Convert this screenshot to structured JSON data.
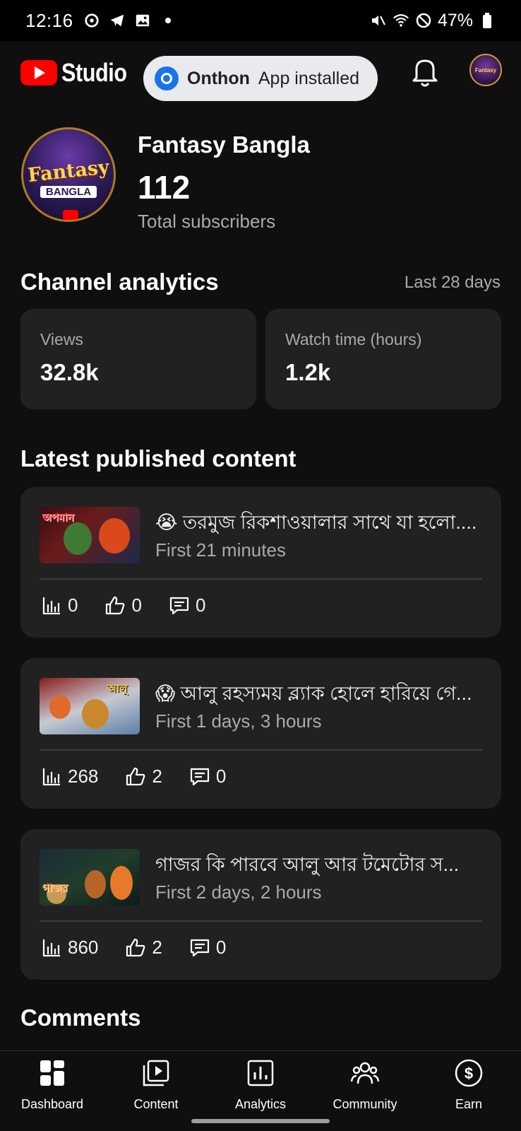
{
  "status_bar": {
    "time": "12:16",
    "battery": "47%"
  },
  "header": {
    "app_name": "Studio",
    "toast": {
      "app": "Onthon",
      "message": "App installed"
    }
  },
  "channel": {
    "name": "Fantasy Bangla",
    "subscribers": "112",
    "subscribers_label": "Total subscribers",
    "avatar_text": [
      "Fantasy",
      "BANGLA"
    ]
  },
  "analytics": {
    "title": "Channel analytics",
    "range": "Last 28 days",
    "views_label": "Views",
    "views_value": "32.8k",
    "watch_label": "Watch time (hours)",
    "watch_value": "1.2k"
  },
  "latest": {
    "title": "Latest published content",
    "items": [
      {
        "title": "😭 তরমুজ রিকশাওয়ালার সাথে যা হলো....",
        "sub": "First 21 minutes",
        "views": "0",
        "likes": "0",
        "comments": "0",
        "thumb_text": "অপমান"
      },
      {
        "title": "😱 আলু রহস্যময় ব্ল্যাক হোলে হারিয়ে গে...",
        "sub": "First 1 days, 3 hours",
        "views": "268",
        "likes": "2",
        "comments": "0",
        "thumb_text": "আলু"
      },
      {
        "title": "গাজর কি পারবে আলু আর টমেটোর স...",
        "sub": "First 2 days, 2 hours",
        "views": "860",
        "likes": "2",
        "comments": "0",
        "thumb_text": "গাজর"
      }
    ]
  },
  "comments_title": "Comments",
  "nav": [
    {
      "label": "Dashboard",
      "icon": "dashboard-icon"
    },
    {
      "label": "Content",
      "icon": "content-icon"
    },
    {
      "label": "Analytics",
      "icon": "analytics-icon"
    },
    {
      "label": "Community",
      "icon": "community-icon"
    },
    {
      "label": "Earn",
      "icon": "earn-icon"
    }
  ]
}
